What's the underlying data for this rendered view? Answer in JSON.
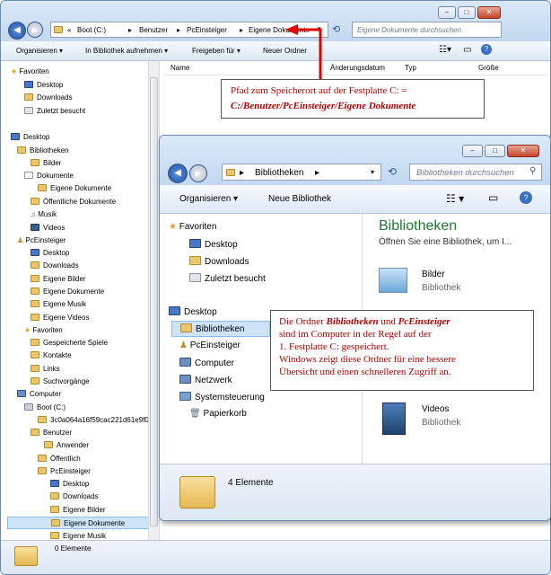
{
  "back_window": {
    "address": [
      "«",
      "Boot (C:)",
      "Benutzer",
      "PcEinsteiger",
      "Eigene Dokumente"
    ],
    "search_placeholder": "Eigene Dokumente durchsuchen",
    "toolbar": {
      "organize": "Organisieren",
      "library": "In Bibliothek aufnehmen",
      "share": "Freigeben für",
      "new_folder": "Neuer Ordner"
    },
    "columns": [
      "Name",
      "Änderungsdatum",
      "Typ",
      "Größe"
    ],
    "tree": [
      "Favoriten",
      "Desktop",
      "Downloads",
      "Zuletzt besucht",
      "Desktop",
      "Bibliotheken",
      "Bilder",
      "Dokumente",
      "Eigene Dokumente",
      "Öffentliche Dokumente",
      "Musik",
      "Videos",
      "PcEinsteiger",
      "Desktop",
      "Downloads",
      "Eigene Bilder",
      "Eigene Dokumente",
      "Eigene Musik",
      "Eigene Videos",
      "Favoriten",
      "Gespeicherte Spiele",
      "Kontakte",
      "Links",
      "Suchvorgänge",
      "Computer",
      "Boot (C:)",
      "3c0a064a16f59cac221d61e9f0",
      "Benutzer",
      "Anwender",
      "Öffentlich",
      "PcEinsteiger",
      "Desktop",
      "Downloads",
      "Eigene Bilder",
      "Eigene Dokumente",
      "Eigene Musik"
    ],
    "status": "0 Elemente"
  },
  "front_window": {
    "address": [
      "Bibliotheken"
    ],
    "search_placeholder": "Bibliotheken durchsuchen",
    "toolbar": {
      "organize": "Organisieren",
      "new_library": "Neue Bibliothek"
    },
    "tree": [
      "Favoriten",
      "Desktop",
      "Downloads",
      "Zuletzt besucht",
      "Desktop",
      "Bibliotheken",
      "PcEinsteiger",
      "Computer",
      "Netzwerk",
      "Systemsteuerung",
      "Papierkorb"
    ],
    "content": {
      "title": "Bibliotheken",
      "subtitle": "Öffnen Sie eine Bibliothek, um I...",
      "items": [
        {
          "name": "Bilder",
          "type": "Bibliothek"
        },
        {
          "name": "Videos",
          "type": "Bibliothek"
        }
      ]
    },
    "status": "4 Elemente"
  },
  "annotation1": {
    "line1": "Pfad zum Speicherort auf der Festplatte C: =",
    "line2": "C:/Benutzer/PcEinsteiger/Eigene Dokumente"
  },
  "annotation2": {
    "p1": "Die Ordner ",
    "b1": "Bibliotheken",
    "p2": " und ",
    "b2": "PcEinsteiger",
    "line2": "sind im Computer in der Regel auf der",
    "line3": "1. Festplatte  C: gespeichert.",
    "line4": "Windows zeigt diese Ordner für eine bessere",
    "line5": "Übersicht und einen schnelleren Zugriff an."
  },
  "colors": {
    "accent": "#1e7a2e",
    "annotation_text": "#b00000",
    "arrow": "#e00000"
  }
}
